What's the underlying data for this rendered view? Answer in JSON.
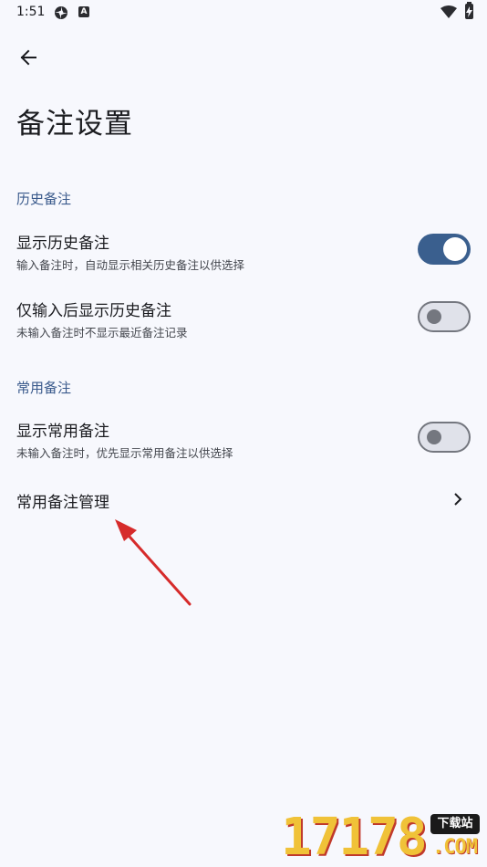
{
  "status_bar": {
    "time": "1:51",
    "icons": [
      "settings-flower-icon",
      "a-badge-icon",
      "wifi-icon",
      "battery-charging-icon"
    ]
  },
  "toolbar": {
    "back_icon": "arrow-left-icon",
    "title": "备注设置"
  },
  "sections": [
    {
      "header": "历史备注",
      "items": [
        {
          "title": "显示历史备注",
          "subtitle": "输入备注时，自动显示相关历史备注以供选择",
          "toggle": true
        },
        {
          "title": "仅输入后显示历史备注",
          "subtitle": "未输入备注时不显示最近备注记录",
          "toggle": false
        }
      ]
    },
    {
      "header": "常用备注",
      "items": [
        {
          "title": "显示常用备注",
          "subtitle": "未输入备注时，优先显示常用备注以供选择",
          "toggle": false
        },
        {
          "title": "常用备注管理",
          "chevron": "chevron-right-icon"
        }
      ]
    }
  ],
  "colors": {
    "background": "#f7f8fd",
    "accent": "#3a5f8e",
    "section_header": "#3a5a8c",
    "annotation_arrow": "#d62b2b"
  },
  "watermark": {
    "number": "17178",
    "badge": "下载站",
    "domain": ".COM"
  }
}
